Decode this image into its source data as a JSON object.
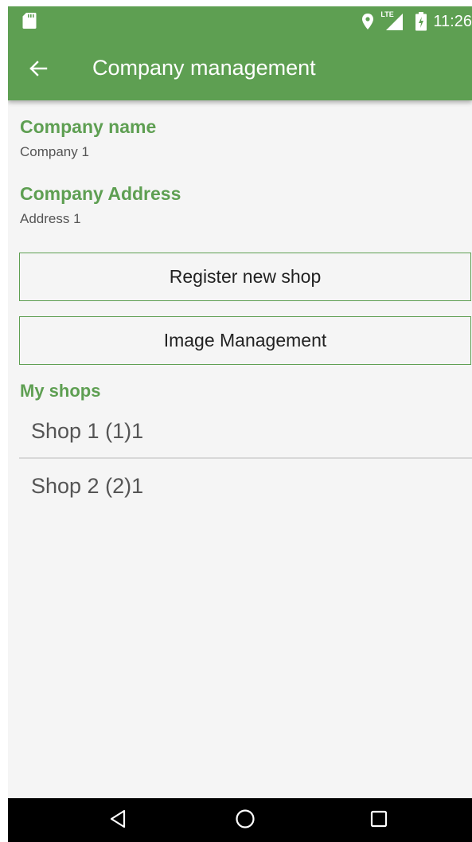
{
  "status_bar": {
    "time": "11:26",
    "network_label": "LTE",
    "icons": [
      "sd-card-icon",
      "location-icon",
      "signal-icon",
      "battery-charging-icon"
    ]
  },
  "app_bar": {
    "title": "Company management",
    "back_icon": "arrow-left-icon",
    "color": "#5e9f52"
  },
  "company": {
    "name_label": "Company name",
    "name_value": "Company 1",
    "address_label": "Company Address",
    "address_value": "Address 1"
  },
  "buttons": {
    "register_shop": "Register new shop",
    "image_management": "Image Management"
  },
  "shops": {
    "section_label": "My shops",
    "items": [
      {
        "label": "Shop 1 (1)1"
      },
      {
        "label": "Shop 2 (2)1"
      }
    ]
  },
  "nav_bar": {
    "icons": [
      "back-triangle-icon",
      "home-circle-icon",
      "recents-square-icon"
    ]
  },
  "colors": {
    "accent": "#5e9f52",
    "background": "#f5f5f5",
    "nav_bar": "#000000"
  }
}
